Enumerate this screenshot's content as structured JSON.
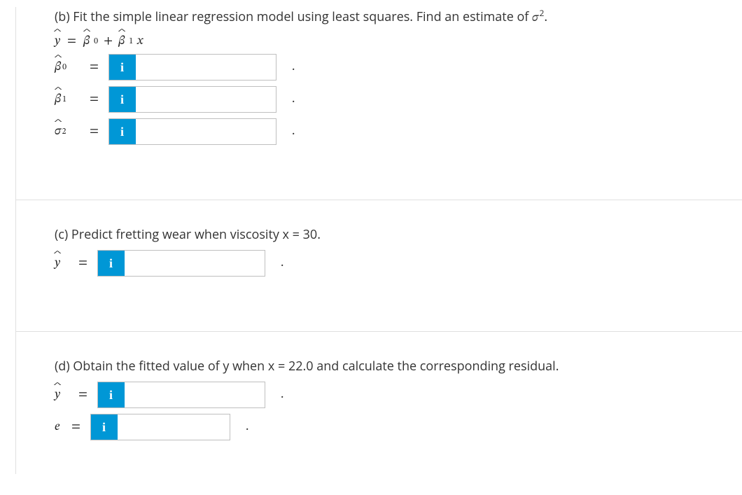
{
  "partB": {
    "prompt_prefix": "(b) Fit the simple linear regression model using least squares. Find an estimate of ",
    "prompt_var": "σ",
    "prompt_sup": "2",
    "prompt_suffix": ".",
    "equation_parts": {
      "yhat": "y",
      "eq": "=",
      "b0": "β",
      "sub0": "0",
      "plus": "+",
      "b1": "β",
      "sub1": "1",
      "x": "x"
    },
    "rows": [
      {
        "var": "β",
        "sub": "0",
        "hat": true
      },
      {
        "var": "β",
        "sub": "1",
        "hat": true
      },
      {
        "var": "σ",
        "sup": "2",
        "hat": true
      }
    ],
    "info_icon": "i",
    "period": "."
  },
  "partC": {
    "prompt": "(c) Predict fretting wear when viscosity x = 30.",
    "var": "y",
    "hat": true,
    "info_icon": "i",
    "period": "."
  },
  "partD": {
    "prompt": "(d) Obtain the fitted value of y when x = 22.0 and calculate the corresponding residual.",
    "rows": [
      {
        "var": "y",
        "hat": true,
        "narrow": false
      },
      {
        "var": "e",
        "hat": false,
        "narrow": true
      }
    ],
    "info_icon": "i",
    "period": "."
  }
}
